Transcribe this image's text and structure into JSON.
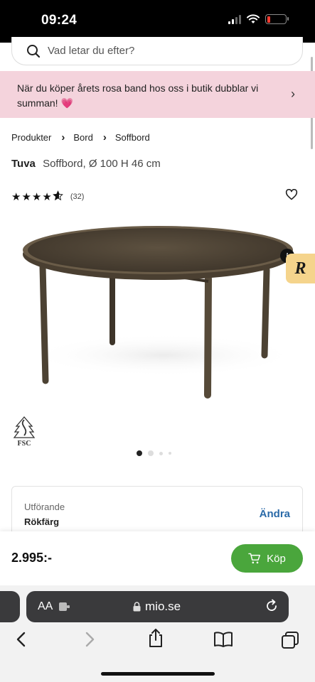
{
  "status_bar": {
    "time": "09:24"
  },
  "search": {
    "placeholder": "Vad letar du efter?"
  },
  "promo": {
    "text": "När du köper årets rosa band hos oss i butik dubblar vi summan! 💗"
  },
  "breadcrumb": [
    "Produkter",
    "Bord",
    "Soffbord"
  ],
  "product": {
    "brand": "Tuva",
    "description": "Soffbord, Ø 100 H 46 cm",
    "rating": 4.5,
    "review_count": "(32)",
    "badge_i": "i",
    "badge_r": "R",
    "fsc_label": "FSC"
  },
  "gallery": {
    "count": 4,
    "active_index": 0
  },
  "option": {
    "label": "Utförande",
    "value": "Rökfärg",
    "change_label": "Ändra"
  },
  "buy_bar": {
    "price": "2.995:-",
    "buy_label": "Köp",
    "accent_color": "#4aa63c"
  },
  "browser": {
    "aa_label": "AA",
    "url": "mio.se"
  },
  "colors": {
    "promo_bg": "#f4d3dc",
    "link": "#2a6aa8"
  },
  "icons": [
    "search-icon",
    "chevron-right-icon",
    "heart-icon",
    "cart-icon",
    "lock-icon",
    "reload-icon",
    "back-icon",
    "forward-icon",
    "share-icon",
    "bookmarks-icon",
    "tabs-icon"
  ]
}
